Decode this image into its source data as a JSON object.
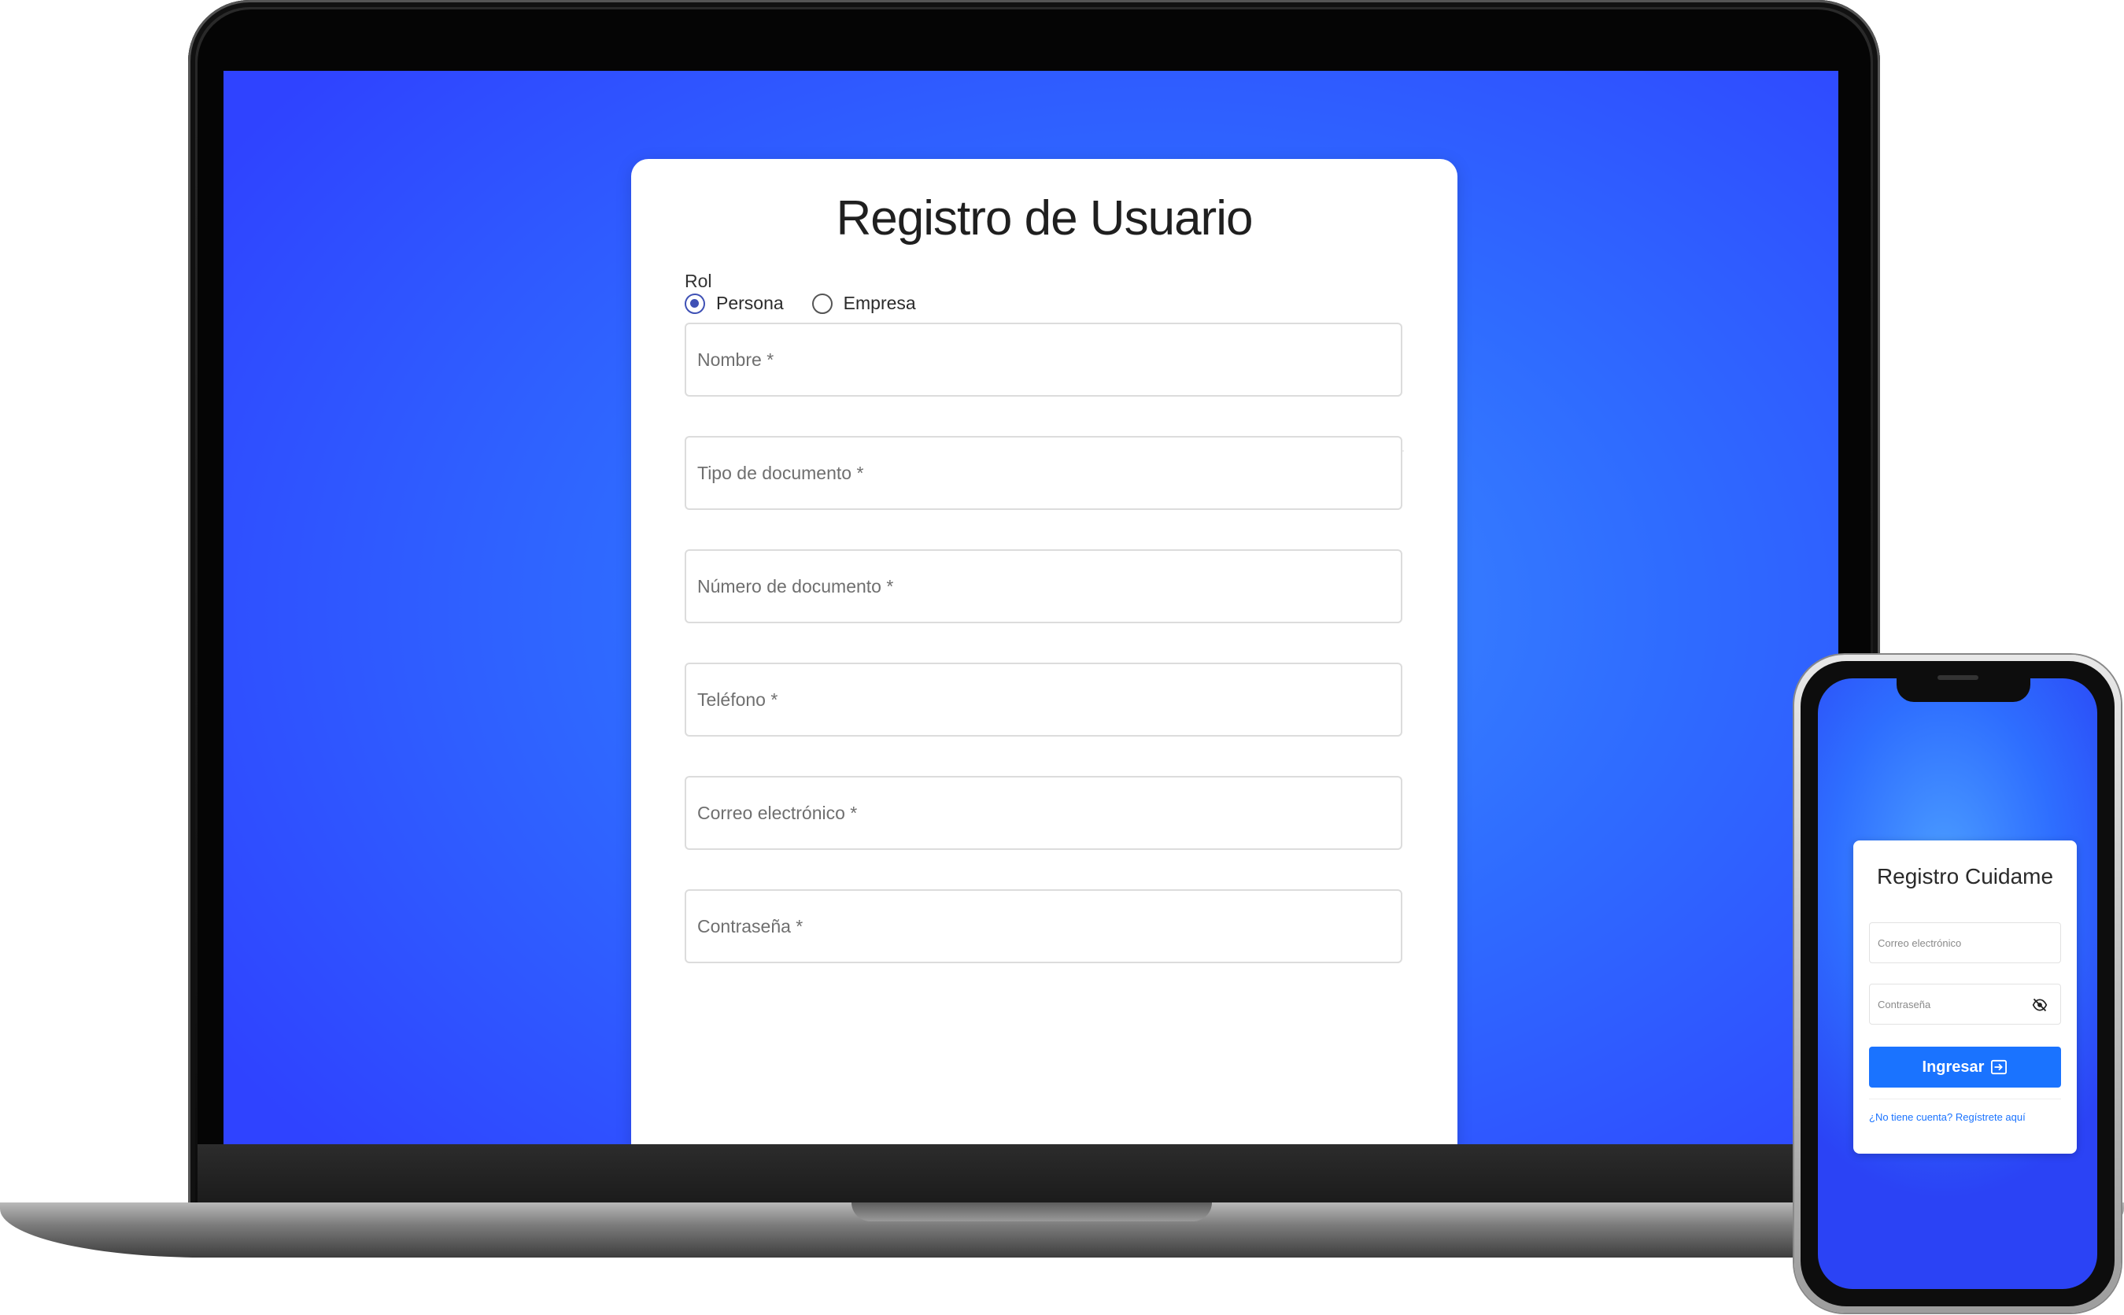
{
  "laptop": {
    "title": "Registro de Usuario",
    "rol_label": "Rol",
    "radio_options": [
      {
        "label": "Persona",
        "selected": true
      },
      {
        "label": "Empresa",
        "selected": false
      }
    ],
    "fields": [
      {
        "label": "Nombre *"
      },
      {
        "label": "Tipo de documento *"
      },
      {
        "label": "Número de documento *"
      },
      {
        "label": "Teléfono *"
      },
      {
        "label": "Correo electrónico *"
      },
      {
        "label": "Contraseña *"
      }
    ]
  },
  "phone": {
    "title": "Registro Cuidame",
    "email_placeholder": "Correo electrónico",
    "password_placeholder": "Contraseña",
    "login_button": "Ingresar",
    "register_link": "¿No tiene cuenta? Regístrete aquí"
  },
  "colors": {
    "background_blue": "#2f6cff",
    "radio_selected": "#3f51b5",
    "button_blue": "#1a73ff"
  },
  "icons": [
    "eye-off-icon",
    "login-icon"
  ]
}
